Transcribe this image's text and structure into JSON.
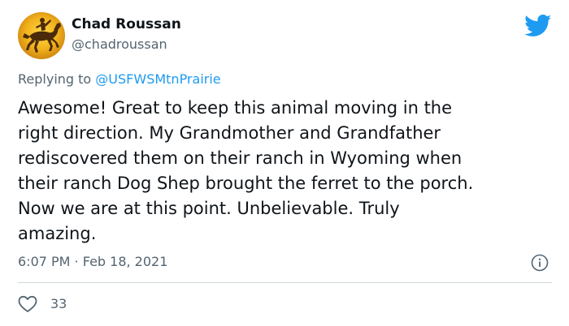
{
  "user": {
    "display_name": "Chad Roussan",
    "handle": "@chadroussan",
    "avatar_icon": "bucking-horse-rider-icon"
  },
  "reply": {
    "prefix": "Replying to ",
    "mention": "@USFWSMtnPrairie"
  },
  "tweet": {
    "text": "Awesome! Great to keep this animal moving in the\nright direction. My Grandmother and Grandfather\nrediscovered them on their ranch in Wyoming when\ntheir ranch Dog Shep brought the ferret to the porch.\nNow we are at this point. Unbelievable. Truly\namazing.",
    "time": "6:07 PM",
    "separator": " · ",
    "date": "Feb 18, 2021"
  },
  "actions": {
    "likes": "33"
  },
  "colors": {
    "brand_blue": "#1d9bf0",
    "secondary_text": "#536471",
    "primary_text": "#0f1419",
    "divider": "#cfd9de"
  }
}
